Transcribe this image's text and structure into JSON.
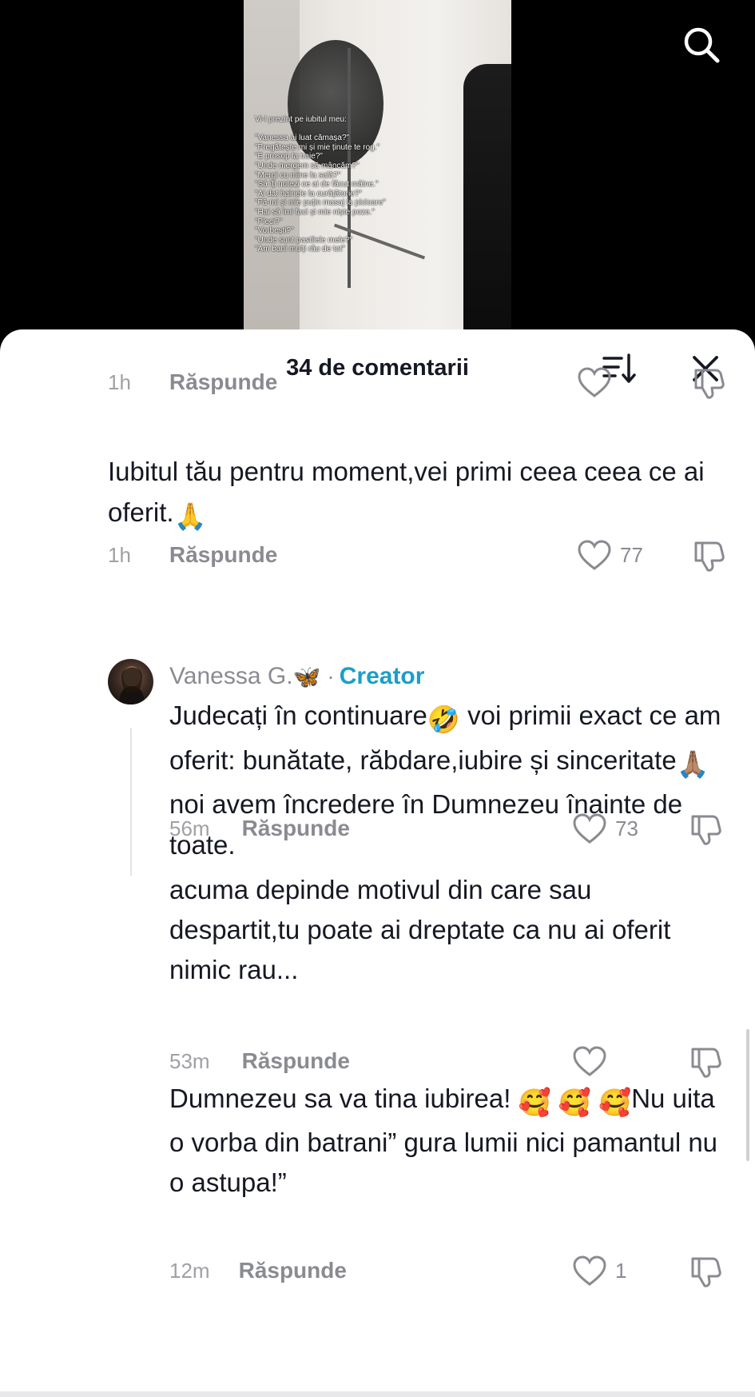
{
  "video": {
    "overlay_lines": [
      "Vi-l prezint pe iubitul meu:",
      "",
      "\"Vanessa ai luat cămașa?\"",
      "\"Pregătește mi și mie ținute te rog.\"",
      "\"E prosop la baie?\"",
      "\"Unde mergem să mâncăm?\"",
      "\"Mergi cu mine la sală?\"",
      "\"Să îți notezi ce ai de făcut mâine.\"",
      "\"Ai dat hainele la curățătorie?\"",
      "\"Fă-mi și mie puțin masaj la picioare\"",
      "\"Hai să îmi faci și mie niște poze.\"",
      "\"Pleci?\"",
      "\"Vorbești?\"",
      "\"Unde sunt pastilele mele?\"",
      "\"Am bani mulți rău de tot\""
    ],
    "search_icon": "search-icon"
  },
  "comments_sheet": {
    "title": "34 de comentarii",
    "sort_icon": "sort-icon",
    "close_icon": "close-icon",
    "comments": [
      {
        "time": "1h",
        "reply_label": "Răspunde",
        "likes": ""
      },
      {
        "text": "Iubitul tău pentru moment,vei primi ceea ceea ce ai oferit.",
        "emoji": "🙏",
        "time": "1h",
        "reply_label": "Răspunde",
        "likes": "77"
      },
      {
        "author": "Vanessa G.",
        "author_emoji": "🦋",
        "separator": "·",
        "badge": "Creator",
        "text_part1": "Judecați în continuare",
        "emoji1": "🤣",
        "text_part2": " voi primii exact ce am oferit: bunătate, răbdare,iubire și sinceritate",
        "emoji2": "🙏🏽",
        "text_part3": " noi avem încredere în Dumnezeu înainte de toate.",
        "time": "56m",
        "reply_label": "Răspunde",
        "likes": "73"
      },
      {
        "text": "acuma depinde motivul din care sau despartit,tu poate ai dreptate ca nu ai oferit nimic rau...",
        "time": "53m",
        "reply_label": "Răspunde",
        "likes": ""
      },
      {
        "text_part1": "Dumnezeu sa va tina iubirea! ",
        "emojis": "🥰 🥰 🥰",
        "text_part2": "Nu uita o vorba din batrani” gura lumii nici pamantul nu o astupa!”",
        "time": "12m",
        "reply_label": "Răspunde",
        "likes": "1"
      }
    ]
  },
  "colors": {
    "accent": "#1a9fc9",
    "text": "#161823",
    "muted": "#8a8b91"
  }
}
